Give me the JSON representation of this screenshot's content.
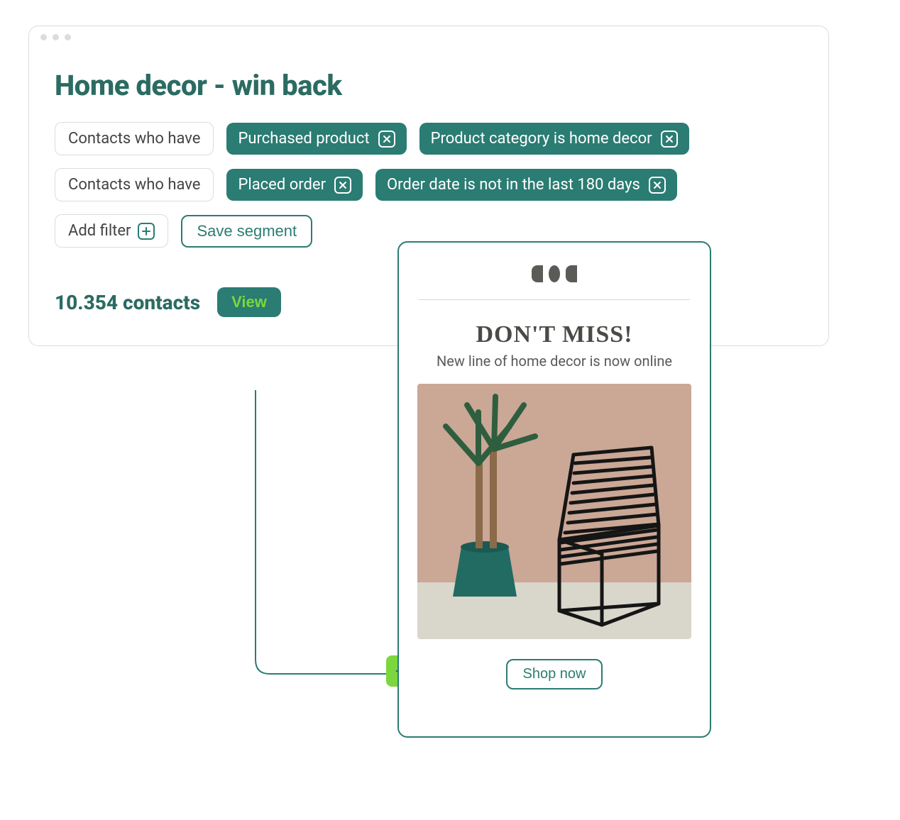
{
  "header": {
    "title": "Home decor - win back"
  },
  "filters": {
    "rows": [
      {
        "qualifier": "Contacts who have",
        "tags": [
          {
            "label": "Purchased product"
          },
          {
            "label": "Product category is home decor"
          }
        ]
      },
      {
        "qualifier": "Contacts who have",
        "tags": [
          {
            "label": "Placed order"
          },
          {
            "label": "Order date is not in the last 180 days"
          }
        ]
      }
    ],
    "add_filter_label": "Add filter",
    "save_segment_label": "Save segment"
  },
  "summary": {
    "count_text": "10.354 contacts",
    "view_label": "View"
  },
  "email": {
    "headline": "DON'T MISS!",
    "subheadline": "New line of home decor is now online",
    "cta_label": "Shop now"
  }
}
